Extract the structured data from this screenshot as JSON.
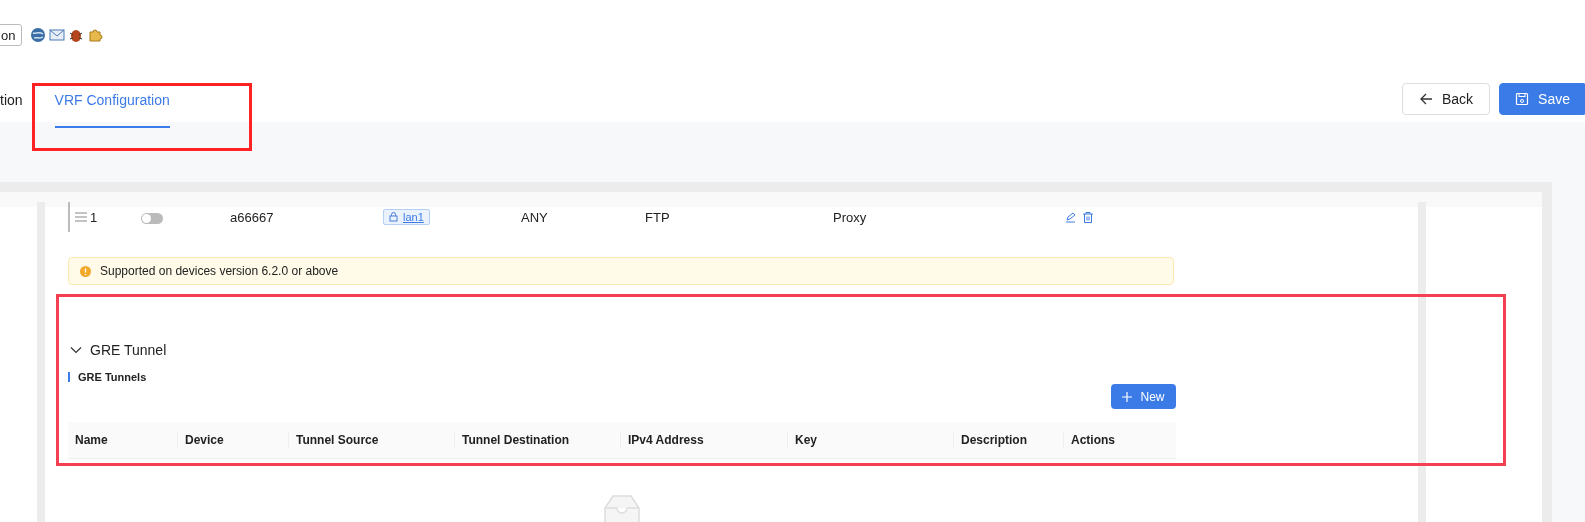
{
  "toolbar": {
    "button": "on"
  },
  "tabs": [
    {
      "label": "tion",
      "selected": false
    },
    {
      "label": "VRF Configuration",
      "selected": true
    }
  ],
  "actions": [
    {
      "label": "Back",
      "kind": "back"
    },
    {
      "label": "Save",
      "kind": "save"
    }
  ],
  "policy_row": {
    "index": "1",
    "enabled": false,
    "name": "a66667",
    "interface": "lan1",
    "source": "ANY",
    "service": "FTP",
    "action": "Proxy"
  },
  "notice": "Supported on devices version 6.2.0 or above",
  "gre": {
    "title": "GRE Tunnel",
    "expanded": true,
    "subtitle": "GRE Tunnels",
    "new_button": "New",
    "columns": [
      "Name",
      "Device",
      "Tunnel Source",
      "Tunnel Destination",
      "IPv4 Address",
      "Key",
      "Description",
      "Actions"
    ]
  }
}
